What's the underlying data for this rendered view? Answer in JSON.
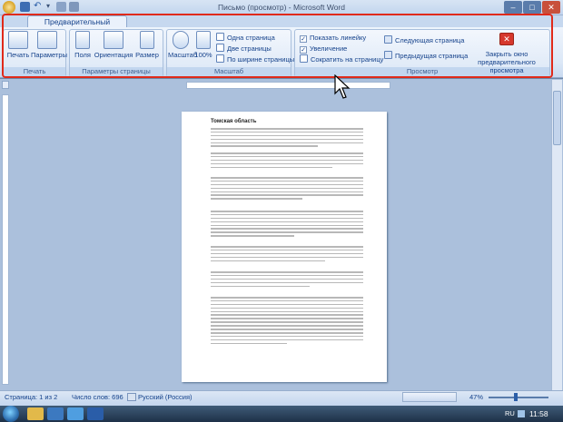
{
  "window": {
    "title": "Письмо (просмотр) - Microsoft Word"
  },
  "ribbon": {
    "tab_label": "Предварительный просмотр",
    "groups": {
      "print": {
        "label": "Печать",
        "print_btn": "Печать",
        "params_btn": "Параметры"
      },
      "page_setup": {
        "label": "Параметры страницы",
        "margins_btn": "Поля",
        "orientation_btn": "Ориентация",
        "size_btn": "Размер"
      },
      "zoom": {
        "label": "Масштаб",
        "zoom_btn": "Масштаб",
        "zoom100_btn": "100%",
        "one_page": "Одна страница",
        "two_pages": "Две страницы",
        "page_width": "По ширине страницы"
      },
      "preview": {
        "label": "Просмотр",
        "show_ruler": "Показать линейку",
        "magnifier": "Увеличение",
        "shrink": "Сократить на страницу",
        "next_page": "Следующая страница",
        "prev_page": "Предыдущая страница",
        "close_btn_line1": "Закрыть окно",
        "close_btn_line2": "предварительного просмотра"
      }
    }
  },
  "document": {
    "heading": "Томская область"
  },
  "status": {
    "page": "Страница: 1 из 2",
    "words": "Число слов: 696",
    "language": "Русский (Россия)",
    "zoom": "47%"
  },
  "taskbar": {
    "lang": "RU",
    "time": "11:58"
  },
  "colors": {
    "accent": "#15428b",
    "highlight_box": "#e02a1a"
  }
}
